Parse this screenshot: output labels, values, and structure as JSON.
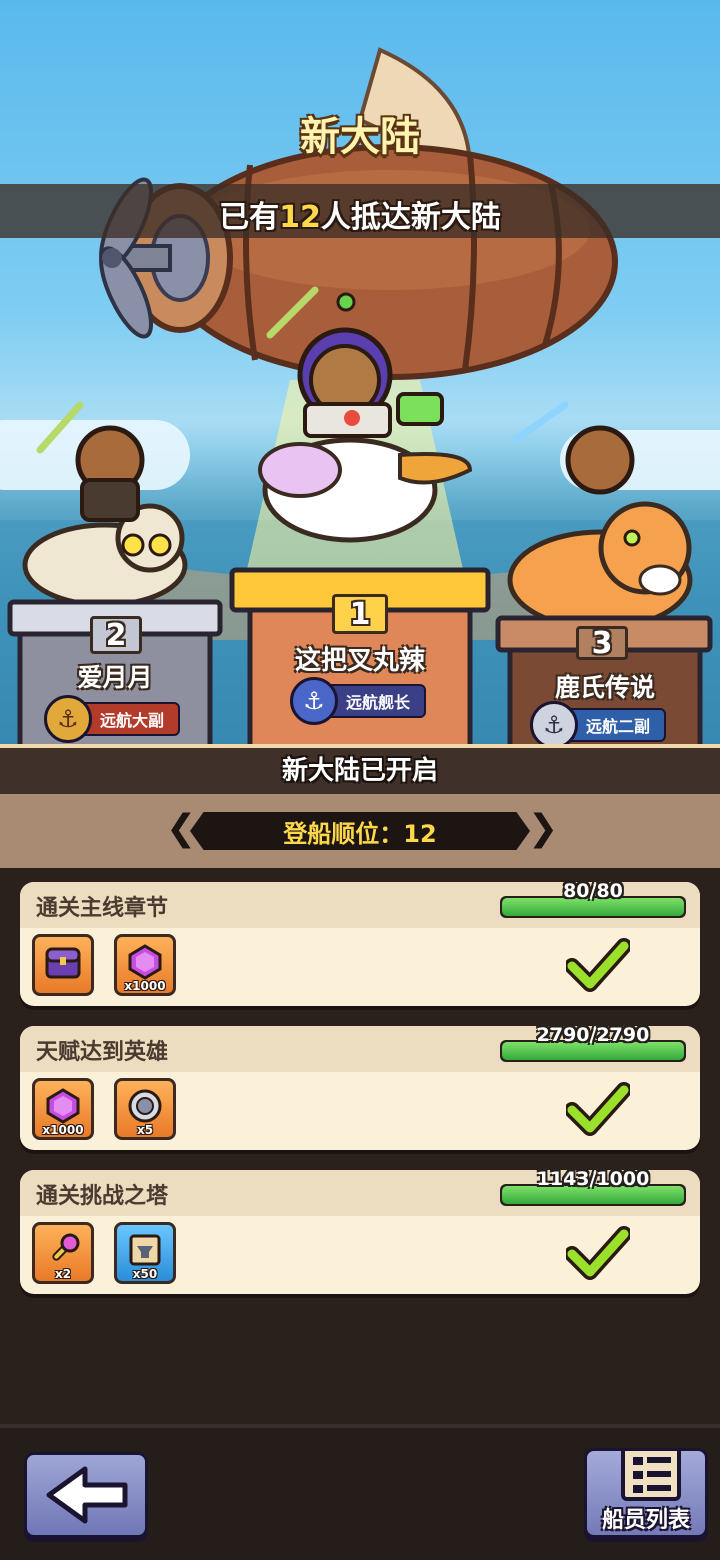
{
  "header": {
    "title": "新大陆",
    "arrive_prefix": "已有",
    "arrive_count": "12",
    "arrive_suffix": "人抵达新大陆"
  },
  "podium": [
    {
      "rank": "1",
      "name": "这把叉丸辣",
      "title": "远航舰长",
      "mount": "pelican",
      "title_color": "#3b3f86"
    },
    {
      "rank": "2",
      "name": "爱月月",
      "title": "远航大副",
      "mount": "mummy-cat",
      "title_color": "#b23b2a"
    },
    {
      "rank": "3",
      "name": "鹿氏传说",
      "title": "远航二副",
      "mount": "sabertooth-tiger",
      "title_color": "#2f5fa8"
    }
  ],
  "status": {
    "text": "新大陆已开启",
    "order_label": "登船顺位：",
    "order_value": "12"
  },
  "tasks": [
    {
      "title": "通关主线章节",
      "progress_text": "80/80",
      "progress": 1.0,
      "completed": true,
      "rewards": [
        {
          "icon": "purple-chest-icon",
          "qty": "",
          "bg": "orange"
        },
        {
          "icon": "purple-gem-icon",
          "qty": "x1000",
          "bg": "orange"
        }
      ]
    },
    {
      "title": "天赋达到英雄",
      "progress_text": "2790/2790",
      "progress": 1.0,
      "completed": true,
      "rewards": [
        {
          "icon": "purple-gem-icon",
          "qty": "x1000",
          "bg": "orange"
        },
        {
          "icon": "silver-coin-icon",
          "qty": "x5",
          "bg": "orange"
        }
      ]
    },
    {
      "title": "通关挑战之塔",
      "progress_text": "1143/1000",
      "progress": 1.0,
      "completed": true,
      "rewards": [
        {
          "icon": "pink-key-icon",
          "qty": "x2",
          "bg": "orange"
        },
        {
          "icon": "anvil-scroll-icon",
          "qty": "x50",
          "bg": "blue"
        }
      ]
    }
  ],
  "footer": {
    "crew_label": "船员列表"
  },
  "colors": {
    "gold_text": "#ffd84a",
    "progress_green": "#35a93a",
    "card_bg": "#fbf1d9"
  }
}
